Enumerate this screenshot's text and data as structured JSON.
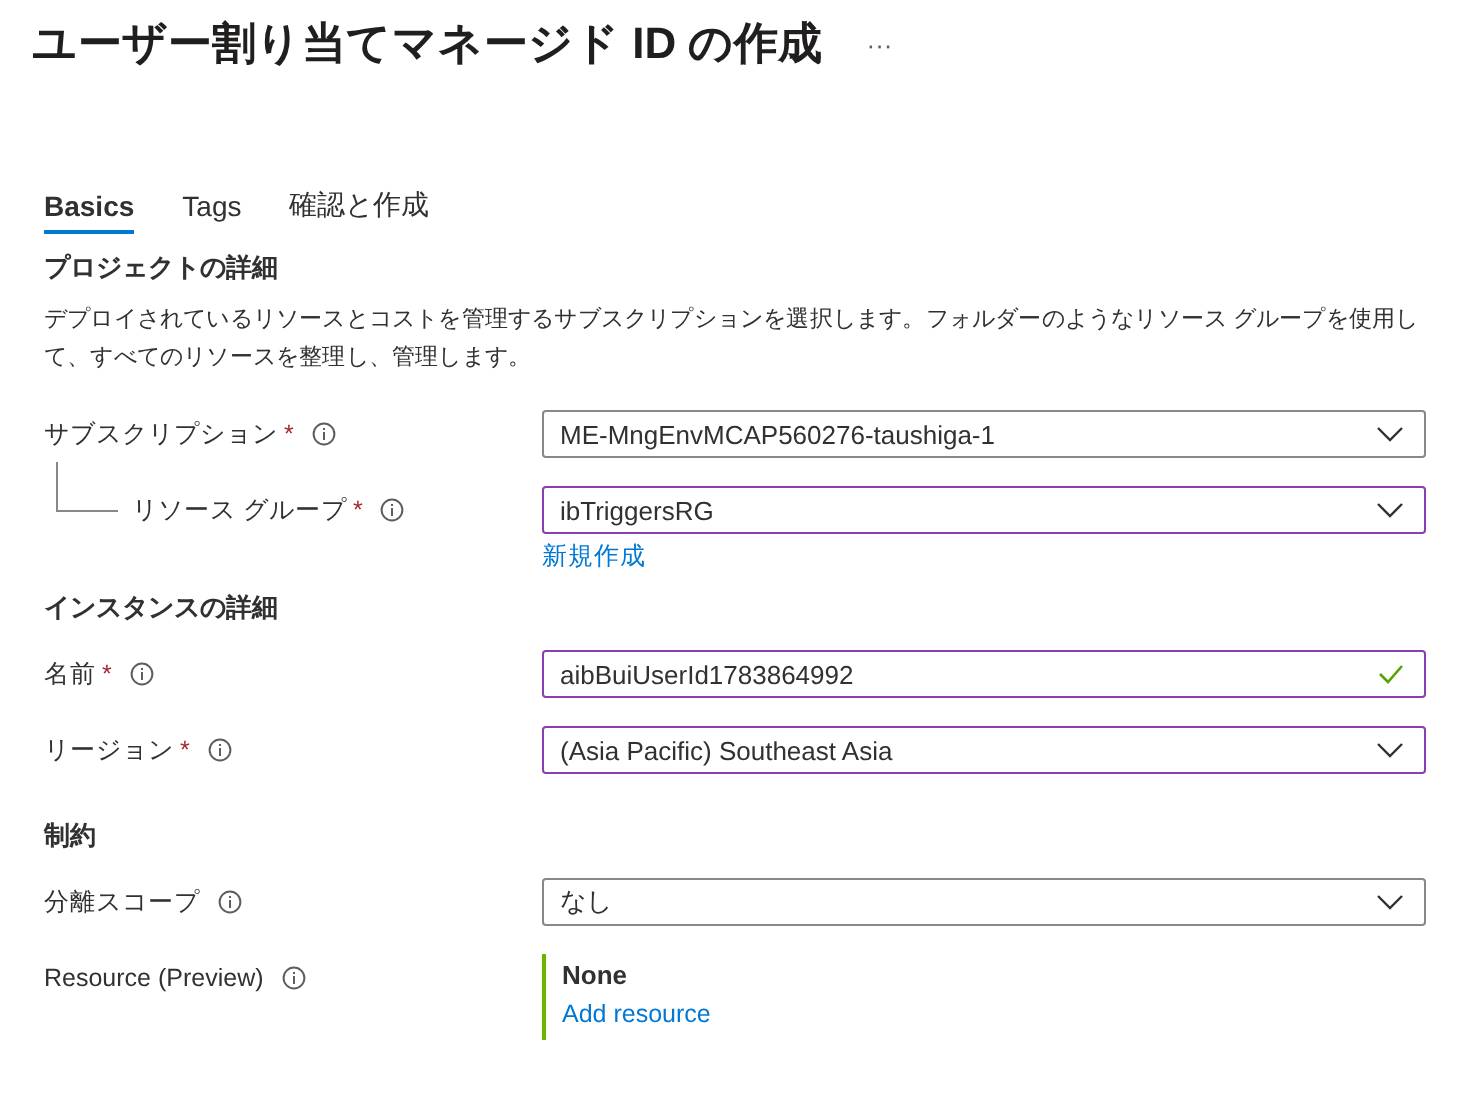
{
  "title": "ユーザー割り当てマネージド ID の作成",
  "more": "···",
  "tabs": [
    {
      "label": "Basics",
      "selected": true
    },
    {
      "label": "Tags",
      "selected": false
    },
    {
      "label": "確認と作成",
      "selected": false
    }
  ],
  "sections": [
    {
      "heading": "プロジェクトの詳細",
      "description": "デプロイされているリソースとコストを管理するサブスクリプションを選択します。フォルダーのようなリソース グループを使用して、すべてのリソースを整理し、管理します。",
      "fields": [
        {
          "label": "サブスクリプション",
          "required_mark": "*",
          "kind": "dropdown",
          "value": "ME-MngEnvMCAP560276-taushiga-1",
          "highlighted": false,
          "valid": false,
          "children": [
            {
              "label": "リソース グループ",
              "required_mark": "*",
              "kind": "dropdown",
              "value": "ibTriggersRG",
              "highlighted": true,
              "valid": false,
              "link": "新規作成"
            }
          ]
        }
      ]
    },
    {
      "heading": "インスタンスの詳細",
      "fields": [
        {
          "label": "名前",
          "required_mark": "*",
          "kind": "text",
          "value": "aibBuiUserId1783864992",
          "highlighted": true,
          "valid": true
        },
        {
          "label": "リージョン",
          "required_mark": "*",
          "kind": "dropdown",
          "value": "(Asia Pacific) Southeast Asia",
          "highlighted": true,
          "valid": false
        }
      ]
    },
    {
      "heading": "制約",
      "fields": [
        {
          "label": "分離スコープ",
          "kind": "dropdown",
          "value": "なし",
          "highlighted": false,
          "valid": false
        },
        {
          "label": "Resource (Preview)",
          "kind": "resource",
          "value": "None",
          "link": "Add resource"
        }
      ]
    }
  ]
}
